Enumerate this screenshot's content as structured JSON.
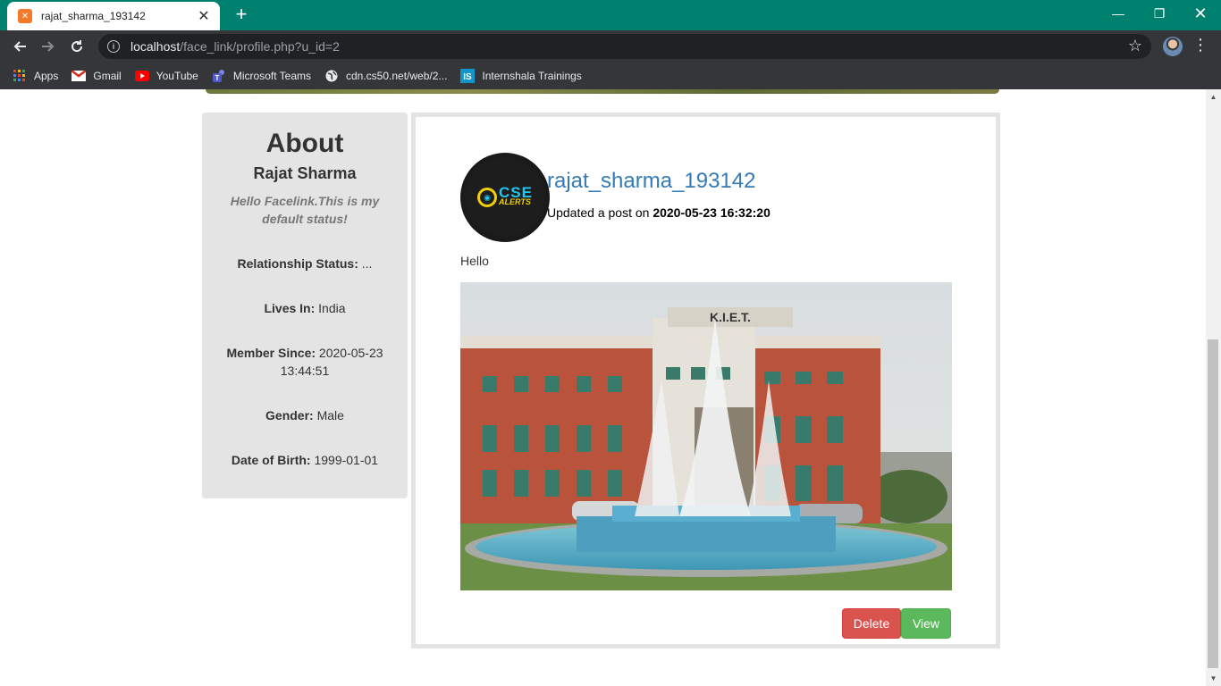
{
  "browser": {
    "tab_title": "rajat_sharma_193142",
    "url_host": "localhost",
    "url_path": "/face_link/profile.php?u_id=2",
    "bookmarks": [
      {
        "label": "Apps",
        "icon": "apps-grid-icon"
      },
      {
        "label": "Gmail",
        "icon": "gmail-icon"
      },
      {
        "label": "YouTube",
        "icon": "youtube-icon"
      },
      {
        "label": "Microsoft Teams",
        "icon": "teams-icon"
      },
      {
        "label": "cdn.cs50.net/web/2...",
        "icon": "globe-icon"
      },
      {
        "label": "Internshala Trainings",
        "icon": "internshala-icon"
      }
    ]
  },
  "about": {
    "heading": "About",
    "name": "Rajat Sharma",
    "status": "Hello Facelink.This is my default status!",
    "relationship_label": "Relationship Status:",
    "relationship_value": "...",
    "lives_label": "Lives In:",
    "lives_value": "India",
    "member_label": "Member Since:",
    "member_value": "2020-05-23 13:44:51",
    "gender_label": "Gender:",
    "gender_value": "Male",
    "dob_label": "Date of Birth:",
    "dob_value": "1999-01-01"
  },
  "post": {
    "username": "rajat_sharma_193142",
    "meta_prefix": "Updated a post on",
    "timestamp": "2020-05-23 16:32:20",
    "text": "Hello",
    "image_sign": "K.I.E.T.",
    "logo_cse": "CSE",
    "logo_alerts": "ALERTS",
    "delete_label": "Delete",
    "view_label": "View"
  },
  "colors": {
    "tab_bar": "#00806e",
    "link": "#337ab7",
    "delete": "#d9534f",
    "view": "#5cb85c"
  }
}
